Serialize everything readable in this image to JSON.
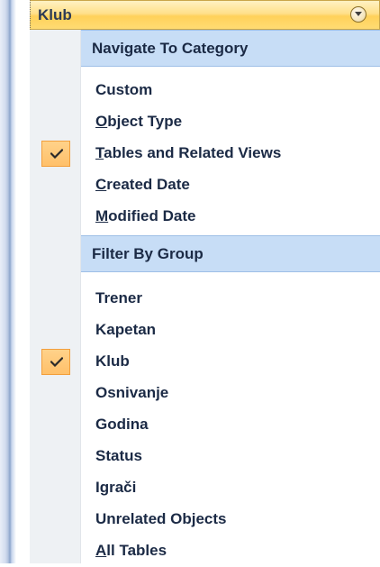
{
  "header": {
    "title": "Klub"
  },
  "menu": {
    "navigate_header": "Navigate To Category",
    "navigate_items": [
      {
        "label": "Custom",
        "mnemonic_before": "",
        "mnemonic": "",
        "mnemonic_after": "Custom",
        "checked": false
      },
      {
        "label": "Object Type",
        "mnemonic_before": "",
        "mnemonic": "O",
        "mnemonic_after": "bject Type",
        "checked": false
      },
      {
        "label": "Tables and Related Views",
        "mnemonic_before": "",
        "mnemonic": "T",
        "mnemonic_after": "ables and Related Views",
        "checked": true
      },
      {
        "label": "Created Date",
        "mnemonic_before": "",
        "mnemonic": "C",
        "mnemonic_after": "reated Date",
        "checked": false
      },
      {
        "label": "Modified Date",
        "mnemonic_before": "",
        "mnemonic": "M",
        "mnemonic_after": "odified Date",
        "checked": false
      }
    ],
    "filter_header": "Filter By Group",
    "filter_items": [
      {
        "label": "Trener",
        "mnemonic_before": "",
        "mnemonic": "",
        "mnemonic_after": "Trener",
        "checked": false
      },
      {
        "label": "Kapetan",
        "mnemonic_before": "",
        "mnemonic": "",
        "mnemonic_after": "Kapetan",
        "checked": false
      },
      {
        "label": "Klub",
        "mnemonic_before": "",
        "mnemonic": "",
        "mnemonic_after": "Klub",
        "checked": true
      },
      {
        "label": "Osnivanje",
        "mnemonic_before": "",
        "mnemonic": "",
        "mnemonic_after": "Osnivanje",
        "checked": false
      },
      {
        "label": "Godina",
        "mnemonic_before": "",
        "mnemonic": "",
        "mnemonic_after": "Godina",
        "checked": false
      },
      {
        "label": "Status",
        "mnemonic_before": "",
        "mnemonic": "",
        "mnemonic_after": "Status",
        "checked": false
      },
      {
        "label": "Igrači",
        "mnemonic_before": "",
        "mnemonic": "",
        "mnemonic_after": "Igrači",
        "checked": false
      },
      {
        "label": "Unrelated Objects",
        "mnemonic_before": "",
        "mnemonic": "",
        "mnemonic_after": "Unrelated Objects",
        "checked": false
      },
      {
        "label": "All Tables",
        "mnemonic_before": "",
        "mnemonic": "A",
        "mnemonic_after": "ll Tables",
        "checked": false
      }
    ]
  },
  "colors": {
    "header_gradient_top": "#fff2c3",
    "header_gradient_bottom": "#ffdb73",
    "section_header_bg": "#c7ddf6",
    "check_bg": "#ffc06a",
    "check_border": "#f29f3d",
    "text": "#1b2a45"
  },
  "icons": {
    "dropdown": "chevron-down-circle-icon",
    "check": "checkmark-icon"
  }
}
